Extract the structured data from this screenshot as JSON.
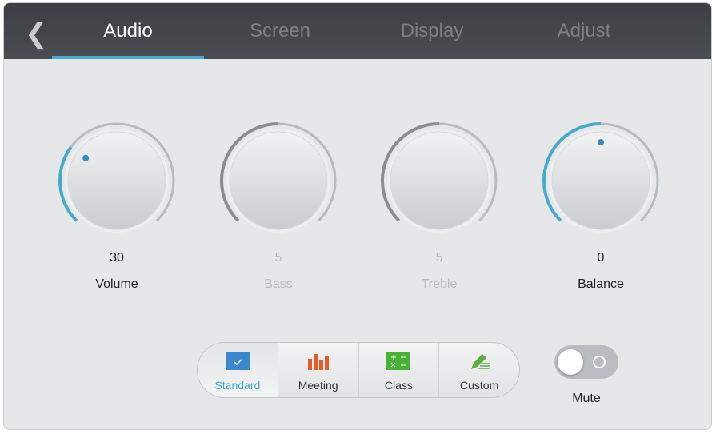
{
  "header": {
    "tabs": [
      {
        "label": "Audio",
        "active": true
      },
      {
        "label": "Screen"
      },
      {
        "label": "Display"
      },
      {
        "label": "Adjust"
      }
    ]
  },
  "knobs": [
    {
      "label": "Volume",
      "value": "30",
      "fraction": 0.3,
      "enabled": true
    },
    {
      "label": "Bass",
      "value": "5",
      "fraction": 0.5,
      "enabled": false
    },
    {
      "label": "Treble",
      "value": "5",
      "fraction": 0.5,
      "enabled": false
    },
    {
      "label": "Balance",
      "value": "0",
      "fraction": 0.5,
      "enabled": true
    }
  ],
  "modes": [
    {
      "label": "Standard",
      "icon": "check-icon",
      "selected": true,
      "color": "#3a87c9"
    },
    {
      "label": "Meeting",
      "icon": "bar-chart-icon",
      "color": "#e35d2a"
    },
    {
      "label": "Class",
      "icon": "math-icon",
      "color": "#4caf3a"
    },
    {
      "label": "Custom",
      "icon": "pencil-icon",
      "color": "#5cae45"
    }
  ],
  "mute": {
    "label": "Mute",
    "on": false
  },
  "colors": {
    "accent": "#4aa8cc",
    "header": "#43464b"
  }
}
